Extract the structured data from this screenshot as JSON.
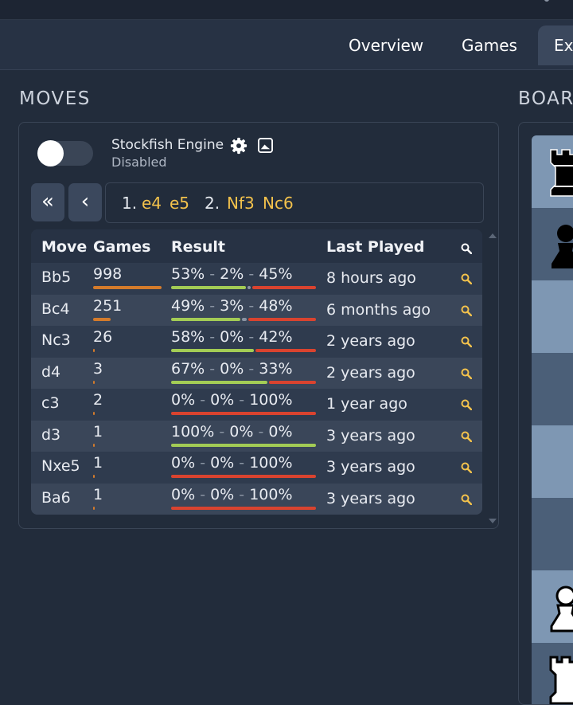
{
  "tabs": [
    {
      "label": "Overview"
    },
    {
      "label": "Games"
    },
    {
      "label": "Ex"
    }
  ],
  "moves_section": {
    "title": "MOVES"
  },
  "board_section": {
    "title": "BOAR"
  },
  "engine": {
    "name": "Stockfish Engine",
    "status": "Disabled",
    "enabled": false
  },
  "navigation": {
    "first_label": "«",
    "prev_label": "‹"
  },
  "move_line": [
    {
      "num": "1.",
      "white": "e4",
      "black": "e5"
    },
    {
      "num": "2.",
      "white": "Nf3",
      "black": "Nc6"
    }
  ],
  "table": {
    "headers": {
      "move": "Move",
      "games": "Games",
      "result": "Result",
      "last_played": "Last Played"
    },
    "rows": [
      {
        "move": "Bb5",
        "games": "998",
        "games_share": 1.0,
        "white": "53%",
        "draw": "2%",
        "black": "45%",
        "last_played": "8 hours ago"
      },
      {
        "move": "Bc4",
        "games": "251",
        "games_share": 0.25,
        "white": "49%",
        "draw": "3%",
        "black": "48%",
        "last_played": "6 months ago"
      },
      {
        "move": "Nc3",
        "games": "26",
        "games_share": 0.026,
        "white": "58%",
        "draw": "0%",
        "black": "42%",
        "last_played": "2 years ago"
      },
      {
        "move": "d4",
        "games": "3",
        "games_share": 0.003,
        "white": "67%",
        "draw": "0%",
        "black": "33%",
        "last_played": "2 years ago"
      },
      {
        "move": "c3",
        "games": "2",
        "games_share": 0.002,
        "white": "0%",
        "draw": "0%",
        "black": "100%",
        "last_played": "1 year ago"
      },
      {
        "move": "d3",
        "games": "1",
        "games_share": 0.001,
        "white": "100%",
        "draw": "0%",
        "black": "0%",
        "last_played": "3 years ago"
      },
      {
        "move": "Nxe5",
        "games": "1",
        "games_share": 0.001,
        "white": "0%",
        "draw": "0%",
        "black": "100%",
        "last_played": "3 years ago"
      },
      {
        "move": "Ba6",
        "games": "1",
        "games_share": 0.001,
        "white": "0%",
        "draw": "0%",
        "black": "100%",
        "last_played": "3 years ago"
      }
    ]
  },
  "colors": {
    "accent_move": "#f3c24c",
    "win": "#a3cc55",
    "draw": "#8a94a3",
    "loss": "#d9432f",
    "games_bar": "#d47b2b",
    "board_light": "#7e97b3",
    "board_dark": "#4b5f78"
  },
  "board_pieces": [
    "black-rook-icon",
    "black-pawn-icon",
    "white-pawn-icon",
    "white-rook-icon"
  ]
}
